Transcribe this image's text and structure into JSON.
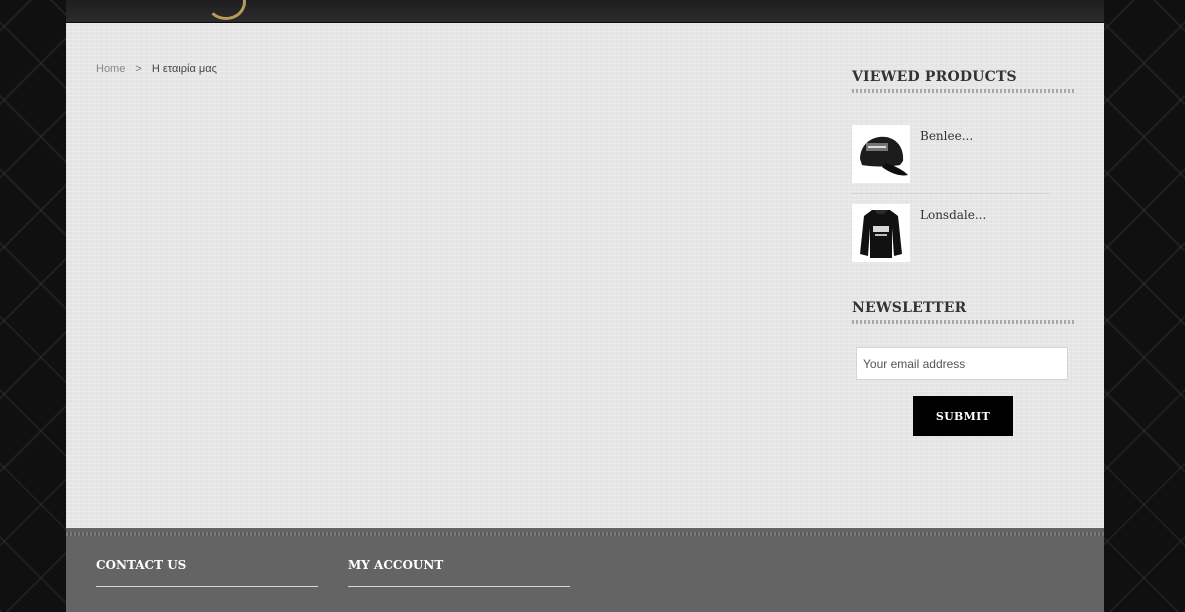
{
  "breadcrumb": {
    "home": "Home",
    "separator": ">",
    "current": "Η εταιρία μας"
  },
  "viewed_products": {
    "title": "VIEWED PRODUCTS",
    "items": [
      {
        "name": "Benlee...",
        "icon": "cap-thumbnail"
      },
      {
        "name": "Lonsdale...",
        "icon": "hoodie-thumbnail"
      }
    ]
  },
  "newsletter": {
    "title": "NEWSLETTER",
    "email_placeholder": "Your email address",
    "submit_label": "SUBMIT"
  },
  "footer": {
    "contact_title": "CONTACT US",
    "account_title": "MY ACCOUNT"
  },
  "colors": {
    "page_background": "#e6e6e6",
    "footer_background": "#646464",
    "button_background": "#000000"
  }
}
